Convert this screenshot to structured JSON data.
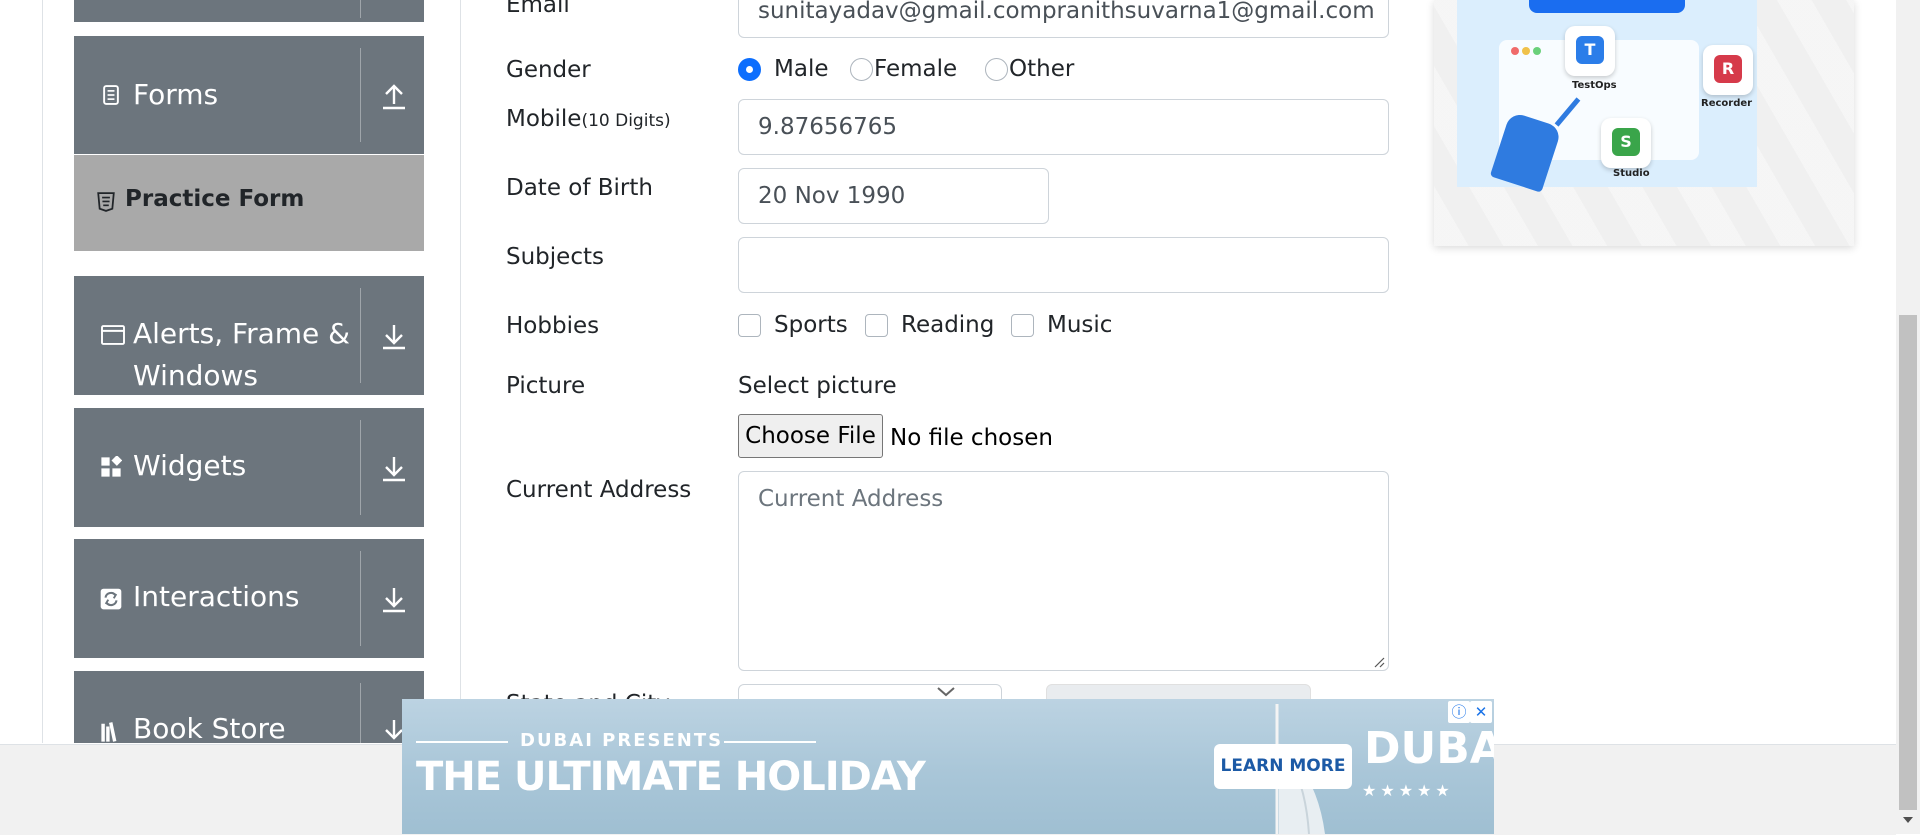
{
  "sidebar": {
    "groups": [
      {
        "label": "Forms",
        "arrow": "up"
      },
      {
        "label": "Alerts, Frame &",
        "label2": "Windows",
        "arrow": "down"
      },
      {
        "label": "Widgets",
        "arrow": "down"
      },
      {
        "label": "Interactions",
        "arrow": "down"
      },
      {
        "label": "Book Store",
        "arrow": "down"
      }
    ],
    "active_item": "Practice Form"
  },
  "form": {
    "email_label": "Email",
    "email_value": "sunitayadav@gmail.compranithsuvarna1@gmail.com",
    "gender_label": "Gender",
    "gender_options": [
      "Male",
      "Female",
      "Other"
    ],
    "gender_selected": "Male",
    "mobile_label": "Mobile",
    "mobile_hint": "(10 Digits)",
    "mobile_value": "9.87656765",
    "dob_label": "Date of Birth",
    "dob_value": "20 Nov 1990",
    "subjects_label": "Subjects",
    "subjects_value": "",
    "hobbies_label": "Hobbies",
    "hobbies_options": [
      "Sports",
      "Reading",
      "Music"
    ],
    "picture_label": "Picture",
    "picture_select_text": "Select picture",
    "choose_file_label": "Choose File",
    "no_file_text": "No file chosen",
    "address_label": "Current Address",
    "address_placeholder": "Current Address",
    "state_city_label": "State and City"
  },
  "right_ad": {
    "items": [
      "TestOps",
      "Recorder",
      "Studio"
    ]
  },
  "bottom_ad": {
    "presents": "DUBAI PRESENTS",
    "headline": "THE ULTIMATE HOLIDAY",
    "cta": "LEARN MORE",
    "brand": "DUBAI",
    "stars": "★★★★★",
    "info_icon": "info-icon",
    "close_icon": "close-icon"
  },
  "colors": {
    "sidebar_header": "#6c757d",
    "active_item": "#a9a9a9",
    "accent": "#0d6efd"
  }
}
